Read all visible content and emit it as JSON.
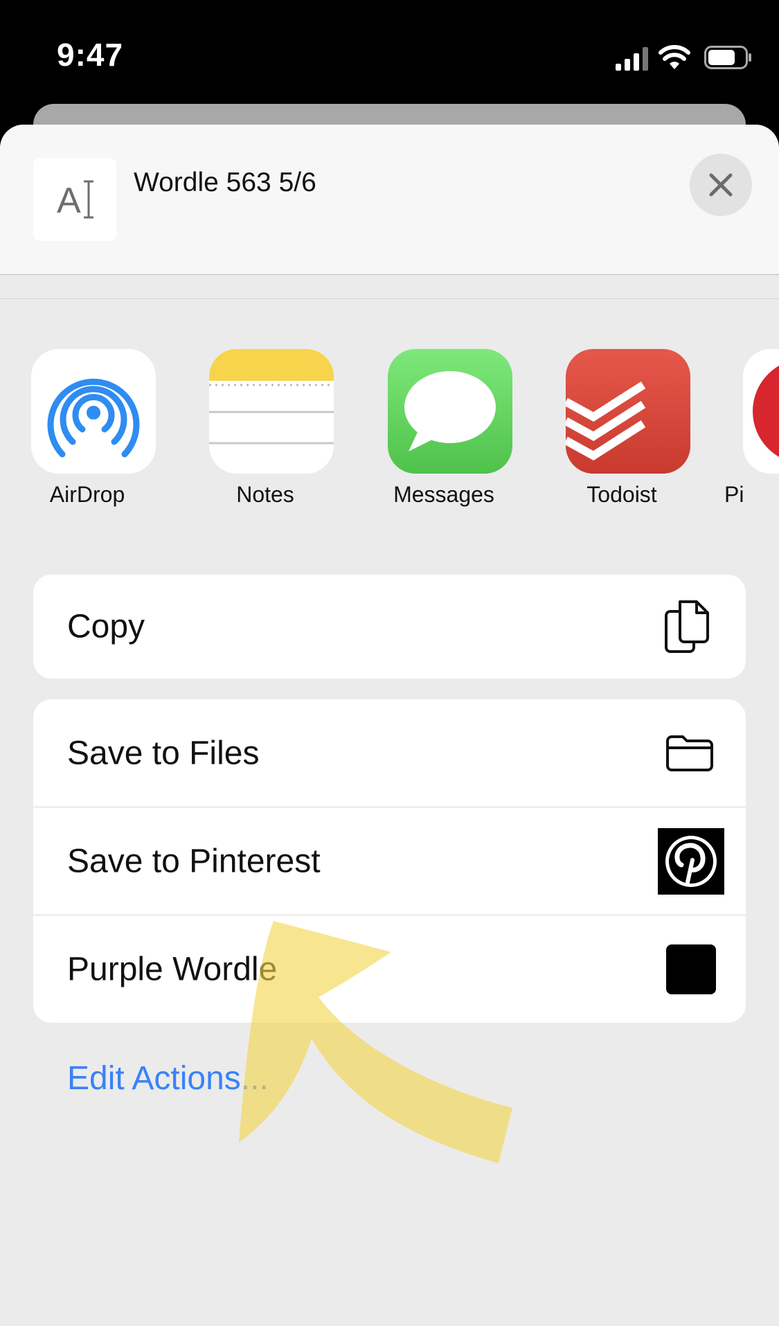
{
  "status_bar": {
    "time": "9:47"
  },
  "share_header": {
    "title": "Wordle 563 5/6",
    "thumbnail_glyph": "A"
  },
  "apps": [
    {
      "label": "AirDrop",
      "icon": "airdrop-icon"
    },
    {
      "label": "Notes",
      "icon": "notes-icon"
    },
    {
      "label": "Messages",
      "icon": "messages-icon"
    },
    {
      "label": "Todoist",
      "icon": "todoist-icon"
    },
    {
      "label": "Pi",
      "icon": "pinterest-app-icon"
    }
  ],
  "actions": {
    "copy": {
      "label": "Copy",
      "icon": "copy-icon"
    },
    "list": [
      {
        "label": "Save to Files",
        "icon": "folder-icon"
      },
      {
        "label": "Save to Pinterest",
        "icon": "pinterest-icon"
      },
      {
        "label": "Purple Wordle",
        "icon": "shortcut-square-icon"
      }
    ]
  },
  "edit_actions": "Edit Actions...",
  "colors": {
    "link": "#3a82f7",
    "highlight": "#f4d54a"
  }
}
